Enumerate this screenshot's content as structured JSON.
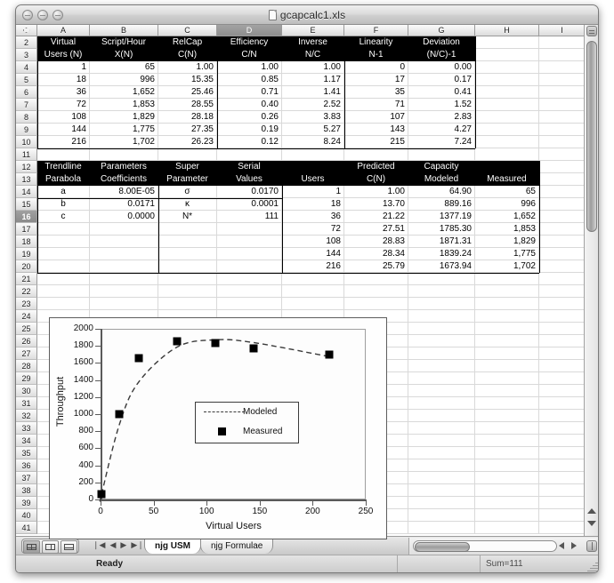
{
  "window": {
    "title": "gcapcalc1.xls",
    "doc_icon": "document-icon",
    "close_label": "",
    "minimize_label": "",
    "zoom_label": ""
  },
  "sheet": {
    "columns": [
      "A",
      "B",
      "C",
      "D",
      "E",
      "F",
      "G",
      "H",
      "I"
    ],
    "selected_column": "D",
    "rows": [
      2,
      3,
      4,
      5,
      6,
      7,
      8,
      9,
      10,
      11,
      12,
      13,
      14,
      15,
      16,
      17,
      18,
      19,
      20,
      21,
      22,
      23,
      24,
      25,
      26,
      27,
      28,
      29,
      30,
      31,
      32,
      33,
      34,
      35,
      36,
      37,
      38,
      39,
      40,
      41
    ],
    "selected_row": 16,
    "table1": {
      "header_row_1": [
        "Virtual",
        "Script/Hour",
        "RelCap",
        "Efficiency",
        "Inverse",
        "Linearity",
        "Deviation"
      ],
      "header_row_2": [
        "Users (N)",
        "X(N)",
        "C(N)",
        "C/N",
        "N/C",
        "N-1",
        "(N/C)-1"
      ],
      "data": [
        [
          "1",
          "65",
          "1.00",
          "1.00",
          "1.00",
          "0",
          "0.00"
        ],
        [
          "18",
          "996",
          "15.35",
          "0.85",
          "1.17",
          "17",
          "0.17"
        ],
        [
          "36",
          "1,652",
          "25.46",
          "0.71",
          "1.41",
          "35",
          "0.41"
        ],
        [
          "72",
          "1,853",
          "28.55",
          "0.40",
          "2.52",
          "71",
          "1.52"
        ],
        [
          "108",
          "1,829",
          "28.18",
          "0.26",
          "3.83",
          "107",
          "2.83"
        ],
        [
          "144",
          "1,775",
          "27.35",
          "0.19",
          "5.27",
          "143",
          "4.27"
        ],
        [
          "216",
          "1,702",
          "26.23",
          "0.12",
          "8.24",
          "215",
          "7.24"
        ]
      ]
    },
    "table2": {
      "header_row_1": [
        "Trendline",
        "Parameters",
        "Super",
        "Serial",
        "",
        "Predicted",
        "Capacity",
        ""
      ],
      "header_row_2": [
        "Parabola",
        "Coefficients",
        "Parameter",
        "Values",
        "Users",
        "C(N)",
        "Modeled",
        "Measured"
      ],
      "data": [
        [
          "a",
          "8.00E-05",
          "σ",
          "0.0170",
          "1",
          "1.00",
          "64.90",
          "65"
        ],
        [
          "b",
          "0.0171",
          "κ",
          "0.0001",
          "18",
          "13.70",
          "889.16",
          "996"
        ],
        [
          "c",
          "0.0000",
          "N*",
          "111",
          "36",
          "21.22",
          "1377.19",
          "1,652"
        ],
        [
          "",
          "",
          "",
          "",
          "72",
          "27.51",
          "1785.30",
          "1,853"
        ],
        [
          "",
          "",
          "",
          "",
          "108",
          "28.83",
          "1871.31",
          "1,829"
        ],
        [
          "",
          "",
          "",
          "",
          "144",
          "28.34",
          "1839.24",
          "1,775"
        ],
        [
          "",
          "",
          "",
          "",
          "216",
          "25.79",
          "1673.94",
          "1,702"
        ]
      ]
    }
  },
  "chart_data": {
    "type": "scatter",
    "title": "",
    "xlabel": "Virtual Users",
    "ylabel": "Throughput",
    "xlim": [
      0,
      250
    ],
    "ylim": [
      0,
      2000
    ],
    "xticks": [
      0,
      50,
      100,
      150,
      200,
      250
    ],
    "yticks": [
      0,
      200,
      400,
      600,
      800,
      1000,
      1200,
      1400,
      1600,
      1800,
      2000
    ],
    "grid": false,
    "legend_position": "center-right-inside",
    "series": [
      {
        "name": "Modeled",
        "style": "dashed-line",
        "x": [
          1,
          18,
          36,
          72,
          108,
          144,
          216
        ],
        "values": [
          64.9,
          889.16,
          1377.19,
          1785.3,
          1871.31,
          1839.24,
          1673.94
        ]
      },
      {
        "name": "Measured",
        "style": "square-marker",
        "x": [
          1,
          18,
          36,
          72,
          108,
          144,
          216
        ],
        "values": [
          65,
          996,
          1652,
          1853,
          1829,
          1775,
          1702
        ]
      }
    ]
  },
  "bottom": {
    "view_buttons": [
      "normal-view-button",
      "page-break-view-button",
      "layout-view-button"
    ],
    "nav_first": "❘◀",
    "nav_prev": "◀",
    "nav_next": "▶",
    "nav_last": "▶❘",
    "tabs": [
      {
        "label": "njg USM",
        "active": true
      },
      {
        "label": "njg Formulae",
        "active": false
      }
    ]
  },
  "status": {
    "message": "Ready",
    "sum": "Sum=111"
  }
}
